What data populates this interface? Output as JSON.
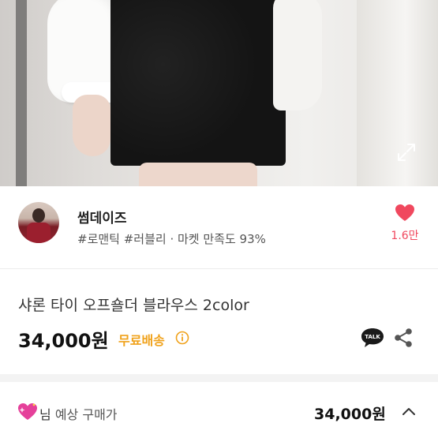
{
  "seller": {
    "name": "썸데이즈",
    "tags": "#로맨틱 #러블리 · 마켓 만족도 93%",
    "like_count": "1.6만"
  },
  "product": {
    "title": "샤론 타이 오프숄더 블라우스 2color",
    "price": "34,000원",
    "shipping_label": "무료배송"
  },
  "estimate": {
    "label_main": "님",
    "label_suffix": "예상 구매가",
    "price": "34,000원"
  },
  "colors": {
    "accent_pink": "#f0485e",
    "shipping_orange": "#f0a21b",
    "talk_icon_bg": "#1a1a1a"
  },
  "icons": {
    "expand": "expand-icon",
    "heart": "heart-icon",
    "info": "info-icon",
    "talk": "talk-icon",
    "share": "share-icon",
    "sparkle_heart": "sparkle-heart-icon",
    "chevron_up": "chevron-up-icon"
  }
}
